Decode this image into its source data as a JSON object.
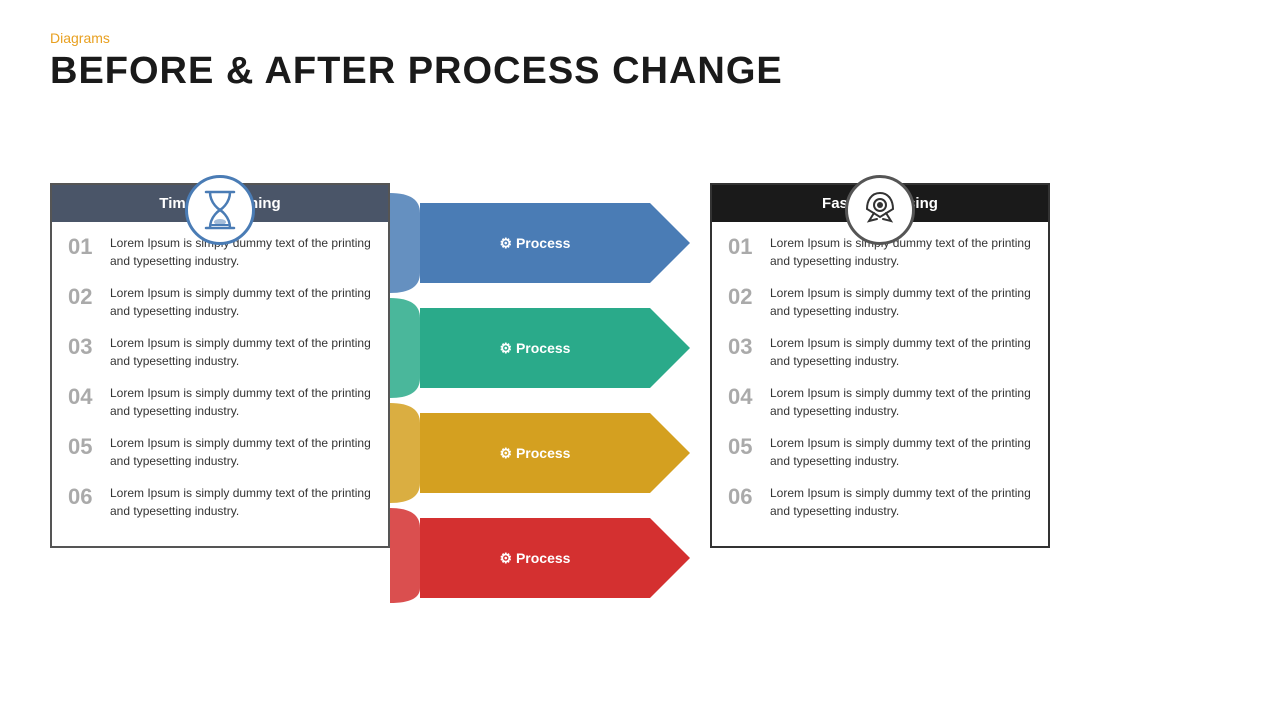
{
  "header": {
    "tag": "Diagrams",
    "title": "BEFORE & AFTER PROCESS CHANGE"
  },
  "left_box": {
    "header": "Time Consuming",
    "items": [
      {
        "num": "01",
        "text": "Lorem Ipsum is simply dummy text of the printing and typesetting industry."
      },
      {
        "num": "02",
        "text": "Lorem Ipsum is simply dummy text of the printing and typesetting industry."
      },
      {
        "num": "03",
        "text": "Lorem Ipsum is simply dummy text of the printing and typesetting industry."
      },
      {
        "num": "04",
        "text": "Lorem Ipsum is simply dummy text of the printing and typesetting industry."
      },
      {
        "num": "05",
        "text": "Lorem Ipsum is simply dummy text of the printing and typesetting industry."
      },
      {
        "num": "06",
        "text": "Lorem Ipsum is simply dummy text of the printing and typesetting industry."
      }
    ]
  },
  "processes": [
    {
      "label": "Process",
      "color": "#4a7cb5"
    },
    {
      "label": "Process",
      "color": "#2aaa8a"
    },
    {
      "label": "Process",
      "color": "#d4a020"
    },
    {
      "label": "Process",
      "color": "#d43030"
    }
  ],
  "right_box": {
    "header": "Fast Processing",
    "items": [
      {
        "num": "01",
        "text": "Lorem Ipsum is simply dummy text of the printing and typesetting industry."
      },
      {
        "num": "02",
        "text": "Lorem Ipsum is simply dummy text of the printing and typesetting industry."
      },
      {
        "num": "03",
        "text": "Lorem Ipsum is simply dummy text of the printing and typesetting industry."
      },
      {
        "num": "04",
        "text": "Lorem Ipsum is simply dummy text of the printing and typesetting industry."
      },
      {
        "num": "05",
        "text": "Lorem Ipsum is simply dummy text of the printing and typesetting industry."
      },
      {
        "num": "06",
        "text": "Lorem Ipsum is simply dummy text of the printing and typesetting industry."
      }
    ]
  },
  "colors": {
    "tag": "#E8A020",
    "title": "#1a1a1a",
    "left_header_bg": "#4a5568",
    "right_header_bg": "#1a1a1a",
    "process1": "#4a7cb5",
    "process2": "#2aaa8a",
    "process3": "#d4a020",
    "process4": "#d43030"
  }
}
